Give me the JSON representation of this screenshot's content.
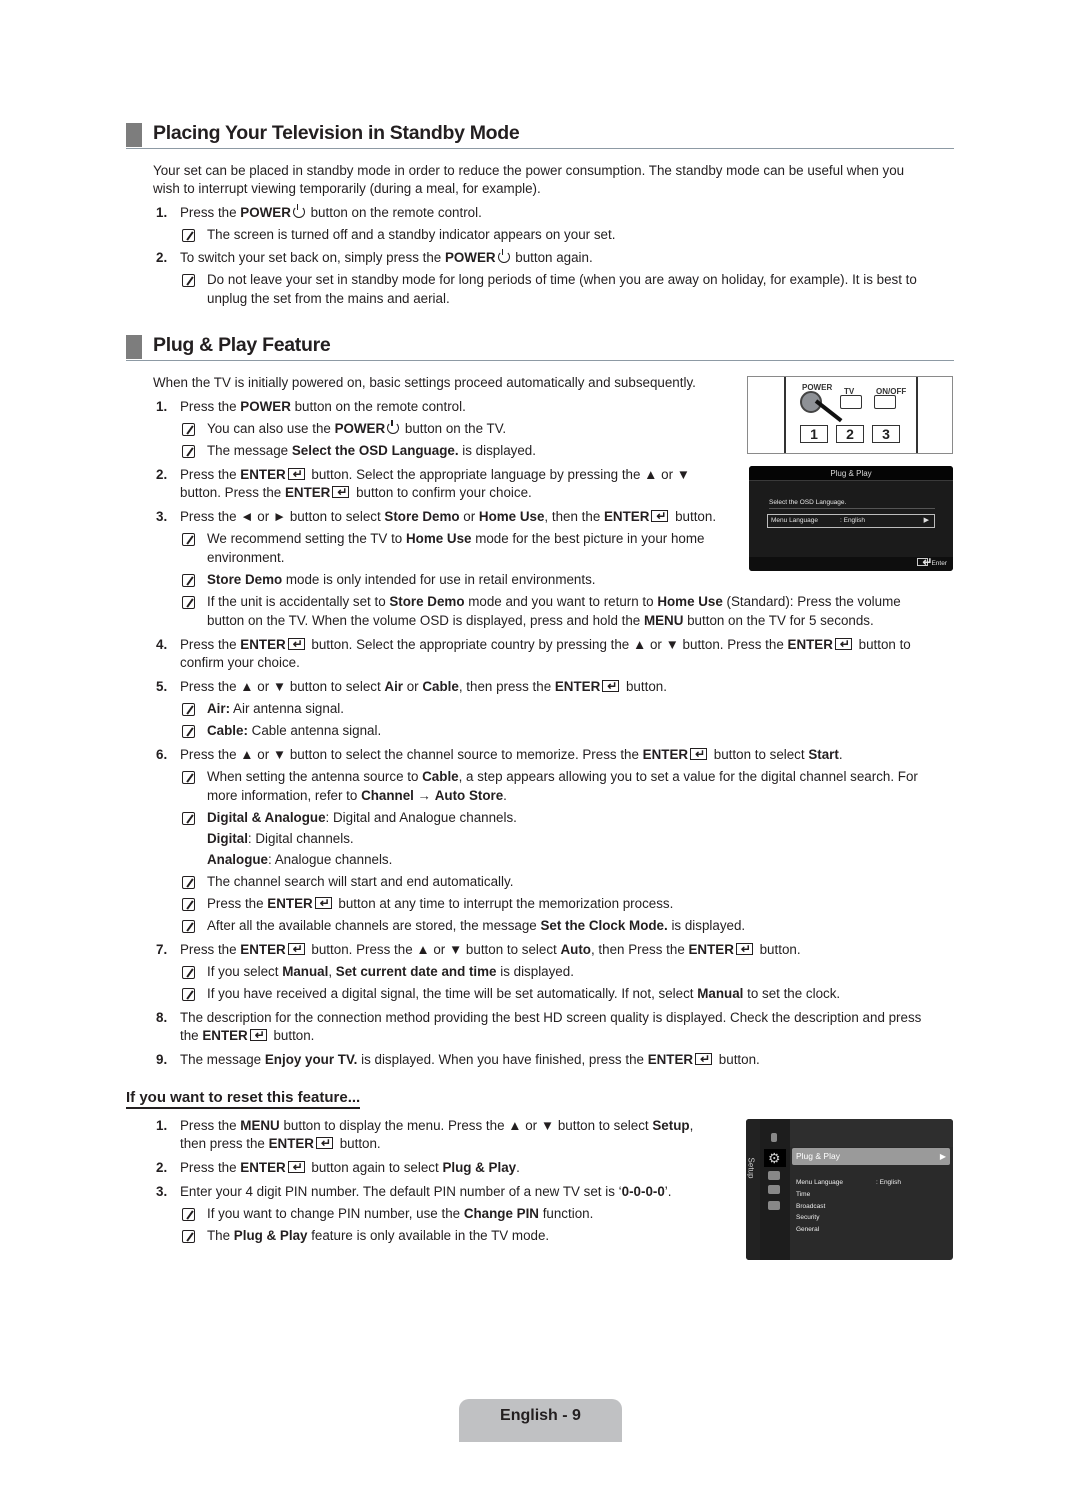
{
  "standby": {
    "heading": "Placing Your Television in Standby Mode",
    "intro_line1": "Your set can be placed in standby mode in order to reduce the power consumption. The standby mode can be useful when you",
    "intro_line2": "wish to interrupt viewing temporarily (during a meal, for example).",
    "step1": {
      "num": "1.",
      "pre": "Press the ",
      "bold": "POWER",
      "post": " button on the remote control."
    },
    "step1_note": "The screen is turned off and a standby indicator appears on your set.",
    "step2": {
      "num": "2.",
      "pre": "To switch your set back on, simply press the ",
      "bold": "POWER",
      "post": " button again."
    },
    "step2_note_line1": "Do not leave your set in standby mode for long periods of time (when you are away on holiday, for example). It is best to",
    "step2_note_line2": "unplug the set from the mains and aerial."
  },
  "plugplay": {
    "heading": "Plug & Play Feature",
    "intro": "When the TV is initially powered on, basic settings proceed automatically and subsequently.",
    "s1": {
      "num": "1.",
      "pre": "Press the ",
      "b1": "POWER",
      "post": " button on the remote control."
    },
    "s1_n1": {
      "pre": "You can also use the ",
      "b1": "POWER",
      "post": " button on the TV."
    },
    "s1_n2": {
      "pre": "The message ",
      "b1": "Select the OSD Language.",
      "post": " is displayed."
    },
    "s2": {
      "num": "2.",
      "l1_pre": "Press the ",
      "l1_b": "ENTER",
      "l1_post": " button. Select the appropriate language by pressing the ▲ or ▼",
      "l2_pre": "button. Press the ",
      "l2_b": "ENTER",
      "l2_post": " button to confirm your choice."
    },
    "s3": {
      "num": "3.",
      "pre": "Press the ◄ or ► button to select ",
      "b1": "Store Demo",
      "mid1": " or ",
      "b2": "Home Use",
      "mid2": ", then the ",
      "b3": "ENTER",
      "post": " button."
    },
    "s3_n1": {
      "pre": "We recommend setting the TV to ",
      "b1": "Home Use",
      "post": " mode for the best picture in your home",
      "l2": "environment."
    },
    "s3_n2": {
      "b1": "Store Demo",
      "post": " mode is only intended for use in retail environments."
    },
    "s3_n3": {
      "pre": "If the unit is accidentally set to ",
      "b1": "Store Demo",
      "mid": " mode and you want to return to ",
      "b2": "Home Use",
      "post": " (Standard): Press the volume",
      "l2_pre": "button on the TV. When the volume OSD is displayed, press and hold the ",
      "l2_b": "MENU",
      "l2_post": " button on the TV for 5 seconds."
    },
    "s4": {
      "num": "4.",
      "pre": "Press the ",
      "b1": "ENTER",
      "mid": " button. Select the appropriate country by pressing the ▲ or ▼ button. Press the ",
      "b2": "ENTER",
      "post": " button to",
      "l2": "confirm your choice."
    },
    "s5": {
      "num": "5.",
      "pre": "Press the ▲ or ▼ button to select ",
      "b1": "Air",
      "mid1": " or ",
      "b2": "Cable",
      "mid2": ", then press the ",
      "b3": "ENTER",
      "post": " button."
    },
    "s5_n1": {
      "b1": "Air:",
      "post": " Air antenna signal."
    },
    "s5_n2": {
      "b1": "Cable:",
      "post": " Cable antenna signal."
    },
    "s6": {
      "num": "6.",
      "pre": "Press the ▲ or ▼ button to select the channel source to memorize. Press the ",
      "b1": "ENTER",
      "mid": " button to select ",
      "b2": "Start",
      "post": "."
    },
    "s6_n1": {
      "pre": "When setting the antenna source to ",
      "b1": "Cable",
      "post": ", a step appears allowing you to set a value for the digital channel search. For",
      "l2_pre": "more information, refer to ",
      "l2_b1": "Channel",
      "l2_arrow": " → ",
      "l2_b2": "Auto Store",
      "l2_post": "."
    },
    "s6_n2": {
      "b1": "Digital & Analogue",
      "post": ": Digital and Analogue channels.",
      "l2_b": "Digital",
      "l2_post": ": Digital channels.",
      "l3_b": "Analogue",
      "l3_post": ": Analogue channels."
    },
    "s6_n3": "The channel search will start and end automatically.",
    "s6_n4": {
      "pre": "Press the ",
      "b1": "ENTER",
      "post": " button at any time to interrupt the memorization process."
    },
    "s6_n5": {
      "pre": "After all the available channels are stored, the message ",
      "b1": "Set the Clock Mode.",
      "post": " is displayed."
    },
    "s7": {
      "num": "7.",
      "pre": "Press the ",
      "b1": "ENTER",
      "mid1": " button. Press the ▲ or ▼ button to select ",
      "b2": "Auto",
      "mid2": ", then Press the ",
      "b3": "ENTER",
      "post": " button."
    },
    "s7_n1": {
      "pre": "If you select ",
      "b1": "Manual",
      "mid": ", ",
      "b2": "Set current date and time",
      "post": " is displayed."
    },
    "s7_n2": {
      "pre": "If you have received a digital signal, the time will be set automatically. If not, select ",
      "b1": "Manual",
      "post": " to set the clock."
    },
    "s8": {
      "num": "8.",
      "l1": "The description for the connection method providing the best HD screen quality is displayed. Check the description and press",
      "l2_pre": "the ",
      "l2_b": "ENTER",
      "l2_post": " button."
    },
    "s9": {
      "num": "9.",
      "pre": "The message ",
      "b1": "Enjoy your TV.",
      "mid": " is displayed. When you have finished, press the ",
      "b2": "ENTER",
      "post": " button."
    }
  },
  "remote_image": {
    "power_label": "POWER",
    "tv_label": "TV",
    "onoff_label": "ON/OFF",
    "keys": [
      "1",
      "2",
      "3"
    ]
  },
  "osd_language": {
    "title": "Plug & Play",
    "message": "Select the OSD Language.",
    "field_label": "Menu Language",
    "field_value": ": English",
    "field_arrow": "▶",
    "footer": "Enter"
  },
  "reset": {
    "heading": "If you want to reset this feature...",
    "r1": {
      "num": "1.",
      "pre": "Press the ",
      "b1": "MENU",
      "mid": " button to display the menu. Press the ▲ or ▼ button to select ",
      "b2": "Setup",
      "post": ",",
      "l2_pre": "then press the ",
      "l2_b": "ENTER",
      "l2_post": " button."
    },
    "r2": {
      "num": "2.",
      "pre": "Press the ",
      "b1": "ENTER",
      "mid": " button again to select ",
      "b2": "Plug & Play",
      "post": "."
    },
    "r3": {
      "num": "3.",
      "pre": "Enter your 4 digit PIN number. The default PIN number of a new TV set is ‘",
      "b1": "0-0-0-0",
      "post": "’."
    },
    "r3_n1": {
      "pre": "If you want to change PIN number, use the ",
      "b1": "Change PIN",
      "post": " function."
    },
    "r3_n2": {
      "pre": "The ",
      "b1": "Plug & Play",
      "post": " feature is only available in the TV mode."
    }
  },
  "setup_menu": {
    "side_label": "Setup",
    "selected": "Plug & Play",
    "selected_arrow": "▶",
    "items": [
      {
        "label": "Menu Language",
        "value": ": English"
      },
      {
        "label": "Time",
        "value": ""
      },
      {
        "label": "Broadcast",
        "value": ""
      },
      {
        "label": "Security",
        "value": ""
      },
      {
        "label": "General",
        "value": ""
      }
    ]
  },
  "footer": {
    "page_label": "English - 9"
  }
}
